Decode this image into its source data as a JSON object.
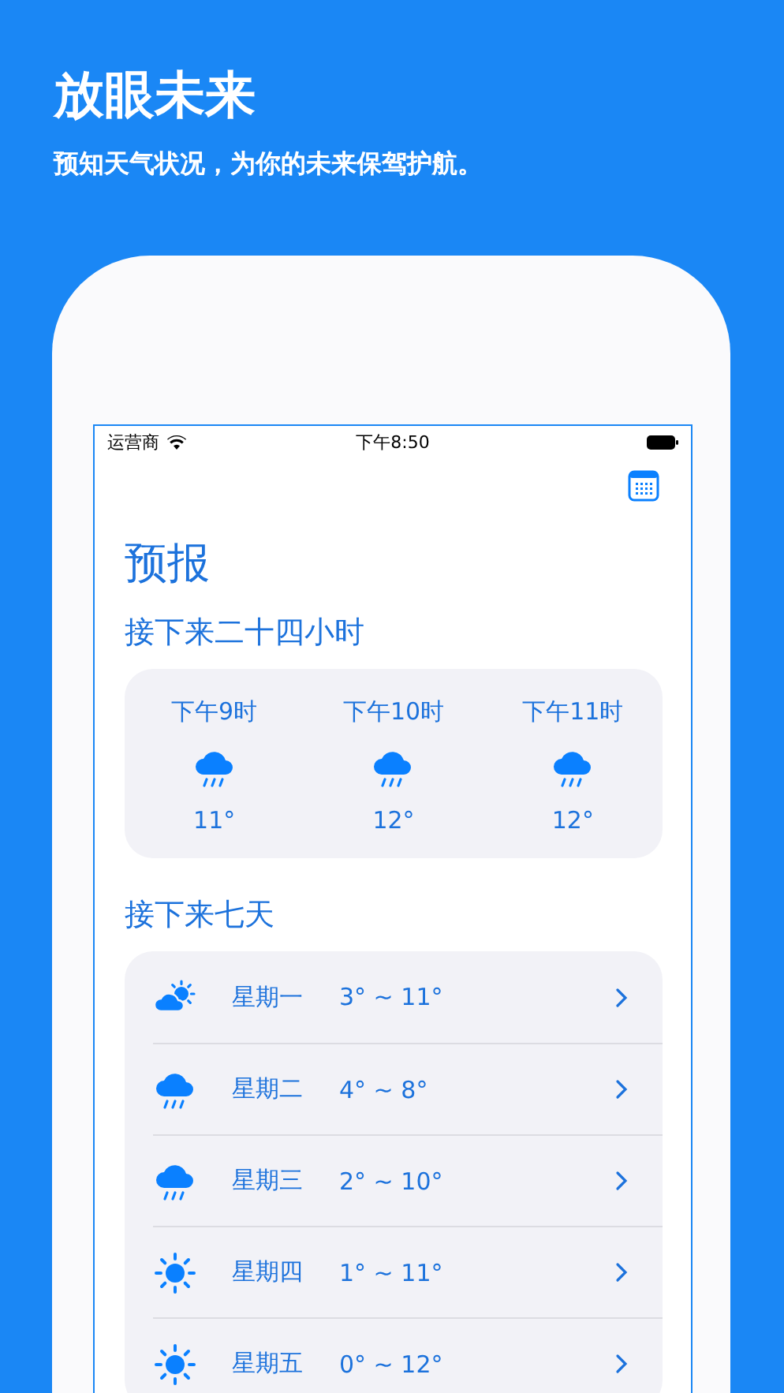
{
  "headline": "放眼未来",
  "tagline": "预知天气状况，为你的未来保驾护航。",
  "status_bar": {
    "carrier": "运营商",
    "time": "下午8:50"
  },
  "title": "预报",
  "hourly": {
    "heading": "接下来二十四小时",
    "items": [
      {
        "time": "下午9时",
        "kind": "rain",
        "temp": "11°"
      },
      {
        "time": "下午10时",
        "kind": "rain",
        "temp": "12°"
      },
      {
        "time": "下午11时",
        "kind": "rain",
        "temp": "12°"
      }
    ]
  },
  "daily": {
    "heading": "接下来七天",
    "items": [
      {
        "day": "星期一",
        "kind": "partly_cloudy",
        "range": "3° ~ 11°"
      },
      {
        "day": "星期二",
        "kind": "rain",
        "range": "4° ~ 8°"
      },
      {
        "day": "星期三",
        "kind": "rain",
        "range": "2° ~ 10°"
      },
      {
        "day": "星期四",
        "kind": "sunny",
        "range": "1° ~ 11°"
      },
      {
        "day": "星期五",
        "kind": "sunny",
        "range": "0° ~ 12°"
      }
    ]
  }
}
